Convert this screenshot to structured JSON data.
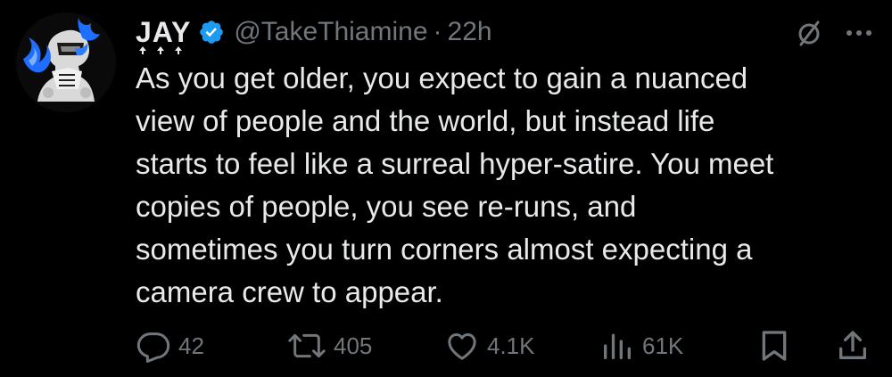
{
  "author": {
    "display_name": "JAY",
    "handle": "@TakeThiamine",
    "separator": "·",
    "time": "22h",
    "verified": true
  },
  "tweet": {
    "text": "As you get older, you expect to gain a nuanced\nview of people and the world, but instead life\nstarts to feel like a surreal hyper-satire. You meet\ncopies of people, you see re-runs, and\nsometimes you turn corners almost expecting a\ncamera crew to appear."
  },
  "actions": {
    "replies": "42",
    "reposts": "405",
    "likes": "4.1K",
    "views": "61K"
  },
  "icons": {
    "verified": "verified-badge-icon",
    "grok": "slashed-circle-icon",
    "more": "more-dots-icon",
    "reply": "reply-icon",
    "repost": "repost-icon",
    "like": "heart-icon",
    "views": "views-bar-chart-icon",
    "bookmark": "bookmark-icon",
    "share": "share-icon"
  },
  "colors": {
    "background": "#000000",
    "text": "#e7e9ea",
    "secondary": "#71767b",
    "verified": "#1d9bf0",
    "avatar_accent": "#1e6fff"
  }
}
